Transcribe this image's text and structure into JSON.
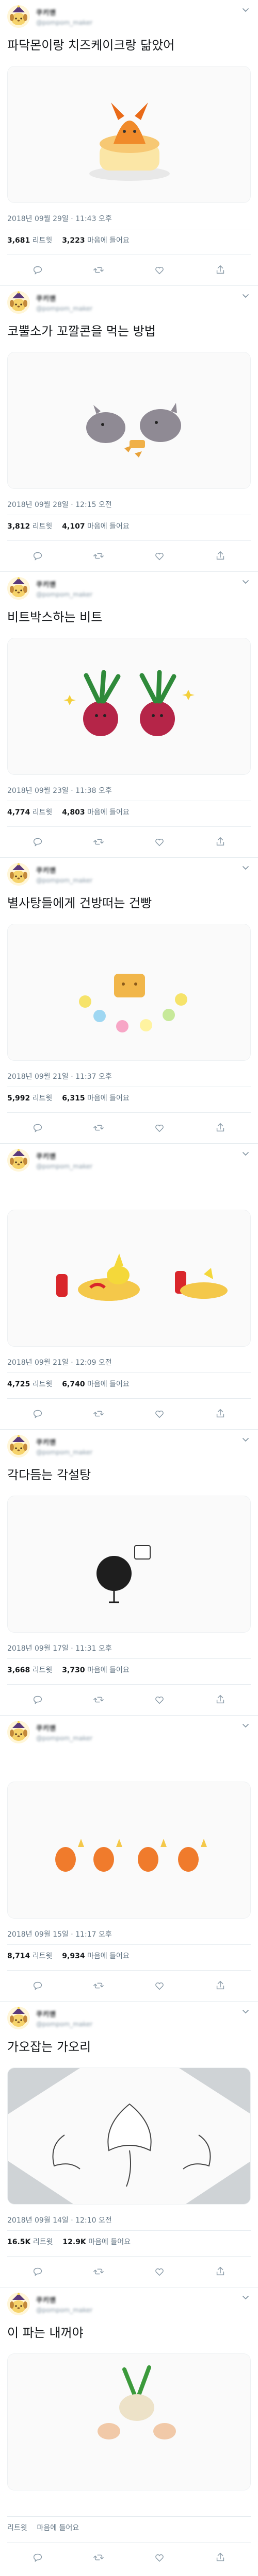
{
  "colors": {
    "accent": "#1da1f2",
    "text": "#14171a",
    "muted": "#657786",
    "border": "#e6ecf0",
    "avatar_bg": "#fff6d8"
  },
  "icons": [
    "pompompurin-avatar",
    "chevron-down-icon",
    "reply-icon",
    "retweet-icon",
    "like-icon",
    "share-icon"
  ],
  "retweet_label": "리트윗",
  "like_label": "마음에 들어요",
  "tweets": [
    {
      "display_name": "쿠키앤",
      "handle": "@pompom_maker",
      "text": "파닥몬이랑 치즈케이크랑 닮았어",
      "date": "2018년 09월 29일 · 11:43 오후",
      "retweets": "3,681",
      "likes": "3,223",
      "image": "파닥몬 치즈케이크"
    },
    {
      "display_name": "쿠키앤",
      "handle": "@pompom_maker",
      "text": "코뿔소가 꼬깔콘을 먹는 방법",
      "date": "2018년 09월 28일 · 12:15 오전",
      "retweets": "3,812",
      "likes": "4,107",
      "image": "코뿔소 꼬깔콘"
    },
    {
      "display_name": "쿠키앤",
      "handle": "@pompom_maker",
      "text": "비트박스하는 비트",
      "date": "2018년 09월 23일 · 11:38 오후",
      "retweets": "4,774",
      "likes": "4,803",
      "image": "비트박스 비트"
    },
    {
      "display_name": "쿠키앤",
      "handle": "@pompom_maker",
      "text": "별사탕들에게 건방떠는 건빵",
      "date": "2018년 09월 21일 · 11:37 오후",
      "retweets": "5,992",
      "likes": "6,315",
      "image": "건빵 별사탕"
    },
    {
      "display_name": "쿠키앤",
      "handle": "@pompom_maker",
      "text": "",
      "date": "2018년 09월 21일 · 12:09 오전",
      "retweets": "4,725",
      "likes": "6,740",
      "image": "피카츄 케첩 오므라이스"
    },
    {
      "display_name": "쿠키앤",
      "handle": "@pompom_maker",
      "text": "각다듬는 각설탕",
      "date": "2018년 09월 17일 · 11:31 오후",
      "retweets": "3,668",
      "likes": "3,730",
      "image": "각설탕"
    },
    {
      "display_name": "쿠키앤",
      "handle": "@pompom_maker",
      "text": "",
      "date": "2018년 09월 15일 · 11:17 오후",
      "retweets": "8,714",
      "likes": "9,934",
      "image": "파이리 행렬"
    },
    {
      "display_name": "쿠키앤",
      "handle": "@pompom_maker",
      "text": "가오잡는 가오리",
      "date": "2018년 09월 14일 · 12:10 오전",
      "retweets": "16.5K",
      "likes": "12.9K",
      "image": "가오리"
    },
    {
      "display_name": "쿠키앤",
      "handle": "@pompom_maker",
      "text": "이 파는 내꺼야",
      "date": "",
      "retweets": "",
      "likes": "",
      "image": "이 파"
    }
  ]
}
